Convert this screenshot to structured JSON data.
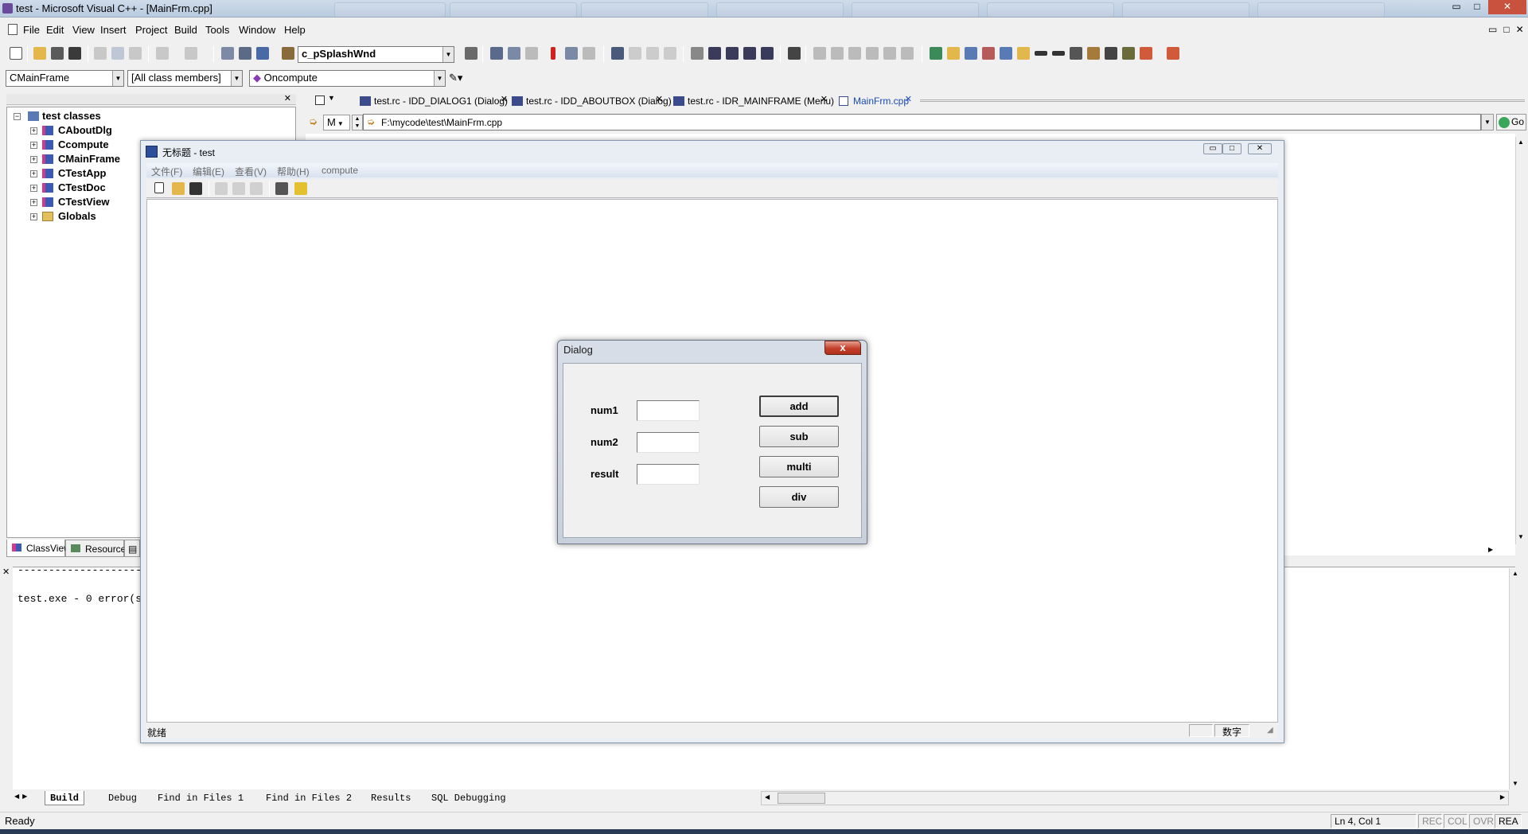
{
  "window": {
    "title": "test - Microsoft Visual C++ - [MainFrm.cpp]",
    "controls": {
      "minimize": "▭",
      "maximize": "□",
      "close": "✕"
    }
  },
  "menubar": {
    "items": [
      {
        "label": "File"
      },
      {
        "label": "Edit"
      },
      {
        "label": "View"
      },
      {
        "label": "Insert"
      },
      {
        "label": "Project"
      },
      {
        "label": "Build"
      },
      {
        "label": "Tools"
      },
      {
        "label": "Window"
      },
      {
        "label": "Help"
      }
    ]
  },
  "toolbar": {
    "search_combo": "c_pSplashWnd",
    "class_combo": "CMainFrame",
    "filter_combo": "[All class members]",
    "member_combo": "Oncompute"
  },
  "class_view": {
    "root": "test classes",
    "items": [
      "CAboutDlg",
      "Ccompute",
      "CMainFrame",
      "CTestApp",
      "CTestDoc",
      "CTestView",
      "Globals"
    ],
    "tabs": [
      "ClassView",
      "Resource"
    ]
  },
  "doc_tabs": [
    {
      "label": "test.rc - IDD_DIALOG1 (Dialog)"
    },
    {
      "label": "test.rc - IDD_ABOUTBOX (Dialog)"
    },
    {
      "label": "test.rc - IDR_MAINFRAME (Menu)"
    },
    {
      "label": "MainFrm.cpp"
    }
  ],
  "nav": {
    "scope": "M",
    "path": "F:\\mycode\\test\\MainFrm.cpp",
    "go": "Go"
  },
  "output": {
    "separator": "----------------------",
    "line": "test.exe - 0 error(s",
    "tabs": [
      "Build",
      "Debug",
      "Find in Files 1",
      "Find in Files 2",
      "Results",
      "SQL Debugging"
    ]
  },
  "statusbar": {
    "text": "Ready",
    "position": "Ln 4, Col 1",
    "indicators": [
      "REC",
      "COL",
      "OVR",
      "REA"
    ]
  },
  "app_window": {
    "title": "无标题 - test",
    "menu": [
      "文件(F)",
      "编辑(E)",
      "查看(V)",
      "帮助(H)",
      "compute"
    ],
    "status_text": "就绪",
    "status_num": "数字"
  },
  "dialog": {
    "title": "Dialog",
    "close": "x",
    "labels": {
      "num1": "num1",
      "num2": "num2",
      "result": "result"
    },
    "values": {
      "num1": "",
      "num2": "",
      "result": ""
    },
    "buttons": {
      "add": "add",
      "sub": "sub",
      "multi": "multi",
      "div": "div"
    }
  },
  "colors": {
    "accent": "#2d4f9a",
    "dialog_close": "#c4402a"
  }
}
